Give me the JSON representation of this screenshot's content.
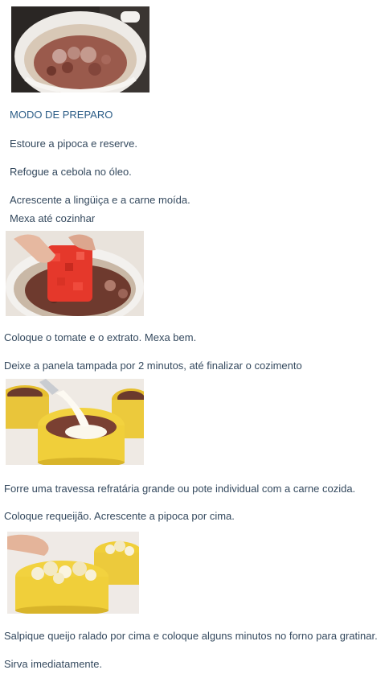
{
  "recipe": {
    "heading": "MODO DE PREPARO",
    "steps": [
      "Estoure a pipoca e reserve.",
      "Refogue a cebola no óleo.",
      "Acrescente a lingüiça e a carne moída.",
      "Mexa até cozinhar",
      "Coloque o tomate e o extrato. Mexa bem.",
      "Deixe a panela tampada por 2 minutos, até finalizar o cozimento",
      "Forre uma travessa refratária grande ou pote individual com a carne cozida.",
      "Coloque requeijão. Acrescente a pipoca por cima.",
      "Salpique queijo ralado por cima e coloque alguns minutos no forno para gratinar.",
      "Sirva imediatamente."
    ]
  },
  "images": [
    {
      "icon": "pot-with-browned-meat-photo"
    },
    {
      "icon": "pot-adding-tomato-photo"
    },
    {
      "icon": "ramekin-adding-requeijao-photo"
    },
    {
      "icon": "ramekin-sprinkling-cheese-photo"
    }
  ],
  "colors": {
    "text": "#34495e",
    "heading": "#2c5d87",
    "pot_white": "#f1efec",
    "meat": "#8b4a3f",
    "tomato": "#e3342a",
    "ramekin_yellow": "#f0cf3a",
    "popcorn": "#f3e9c4"
  }
}
